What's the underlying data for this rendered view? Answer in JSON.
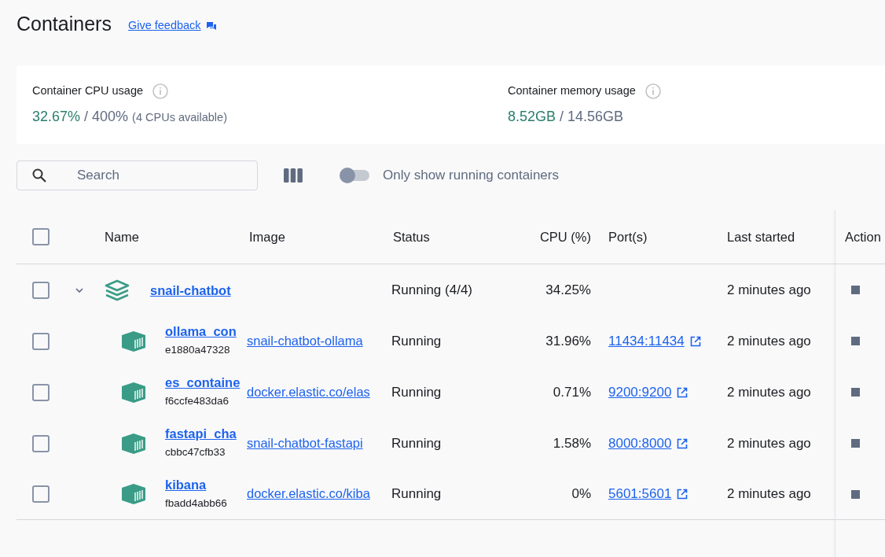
{
  "page": {
    "title": "Containers",
    "feedback_link": "Give feedback"
  },
  "stats": [
    {
      "label": "Container CPU usage",
      "used": "32.67%",
      "total": "/ 400%",
      "note": "(4 CPUs available)"
    },
    {
      "label": "Container memory usage",
      "used": "8.52GB",
      "total": "/ 14.56GB"
    }
  ],
  "toolbar": {
    "search": {
      "placeholder": "Search"
    },
    "running_only": {
      "label": "Only show running containers",
      "on": false
    }
  },
  "table": {
    "select_all": {
      "checked": false
    },
    "columns": [
      "Name",
      "Image",
      "Status",
      "CPU (%)",
      "Port(s)",
      "Last started",
      "Action"
    ],
    "rows": [
      {
        "kind": "group",
        "checked": false,
        "expanded": true,
        "name": "snail-chatbot",
        "status": "Running (4/4)",
        "cpu": "34.25%",
        "last_started": "2 minutes ago"
      },
      {
        "kind": "container",
        "checked": false,
        "name": "ollama_con",
        "id": "e1880a47328",
        "image": "snail-chatbot-ollama",
        "status": "Running",
        "cpu": "31.96%",
        "ports": "11434:11434",
        "last_started": "2 minutes ago"
      },
      {
        "kind": "container",
        "checked": false,
        "name": "es_containe",
        "id": "f6ccfe483da6",
        "image": "docker.elastic.co/elas",
        "status": "Running",
        "cpu": "0.71%",
        "ports": "9200:9200",
        "last_started": "2 minutes ago"
      },
      {
        "kind": "container",
        "checked": false,
        "name": "fastapi_cha",
        "id": "cbbc47cfb33",
        "image": "snail-chatbot-fastapi",
        "status": "Running",
        "cpu": "1.58%",
        "ports": "8000:8000",
        "last_started": "2 minutes ago"
      },
      {
        "kind": "container",
        "checked": false,
        "name": "kibana",
        "id": "fbadd4abb66",
        "image": "docker.elastic.co/kiba",
        "status": "Running",
        "cpu": "0%",
        "ports": "5601:5601",
        "last_started": "2 minutes ago"
      }
    ]
  }
}
